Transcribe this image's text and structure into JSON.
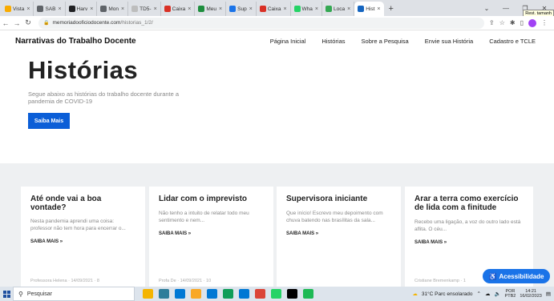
{
  "browser": {
    "tabs": [
      {
        "label": "Vista",
        "color": "#f9ab00"
      },
      {
        "label": "SAB",
        "color": "#5f6368"
      },
      {
        "label": "Harv",
        "color": "#202124"
      },
      {
        "label": "Mon",
        "color": "#5f6368"
      },
      {
        "label": "TD5-",
        "color": "#bdbdbd"
      },
      {
        "label": "Caixa",
        "color": "#d93025"
      },
      {
        "label": "Meu",
        "color": "#1e8e3e"
      },
      {
        "label": "Sup",
        "color": "#1a73e8"
      },
      {
        "label": "Caixa",
        "color": "#d93025"
      },
      {
        "label": "Wha",
        "color": "#25d366"
      },
      {
        "label": "Loca",
        "color": "#34a853"
      },
      {
        "label": "Hist",
        "color": "#1565c0"
      }
    ],
    "new_tab": "+",
    "tooltip": "Rest. tamanh",
    "url_domain": "memoriadooficiodocente.com",
    "url_path": "/historias_1/2/"
  },
  "site": {
    "title": "Narrativas do Trabalho Docente",
    "nav": [
      "Página Inicial",
      "Histórias",
      "Sobre a Pesquisa",
      "Envie sua História",
      "Cadastro e TCLE"
    ]
  },
  "hero": {
    "title": "Histórias",
    "subtitle": "Segue abaixo as histórias do trabalho docente durante a pandemia de COVID-19",
    "button": "Saiba Mais"
  },
  "cards": [
    {
      "title": "Até onde vai a boa vontade?",
      "excerpt": "Nesta pandemia aprendi uma coisa: professor não tem hora para encerrar o...",
      "more": "SAIBA MAIS »",
      "meta": "Professora Helena · 14/09/2021 · 8"
    },
    {
      "title": "Lidar com o imprevisto",
      "excerpt": "   Não tenho a intuito de relatar todo meu sentimento e nem...",
      "more": "SAIBA MAIS »",
      "meta": "Profa De · 14/09/2021 · 10"
    },
    {
      "title": "Supervisora iniciante",
      "excerpt": "Que início! Escrevo meu depoimento com chuva batendo nas brasílitas da sala...",
      "more": "SAIBA MAIS »",
      "meta": ""
    },
    {
      "title": "Arar a terra como exercício de lida com a finitude",
      "excerpt": "Recebo uma ligação, a voz do outro lado está aflita. O céu...",
      "more": "SAIBA MAIS »",
      "meta": "Cristiane Bremenkamp · 1"
    }
  ],
  "accessibility_button": "Acessibilidade",
  "taskbar": {
    "search_placeholder": "Pesquisar",
    "weather": "31°C  Parc ensolarado",
    "lang_line1": "POR",
    "lang_line2": "PTB2",
    "time": "14:21",
    "date": "16/02/2023",
    "icon_colors": [
      "#f4b400",
      "#2d7d9a",
      "#0078d4",
      "#f9a825",
      "#0078d4",
      "#0f9d58",
      "#0078d4",
      "#db4437",
      "#25d366",
      "#000000",
      "#1db954"
    ]
  }
}
